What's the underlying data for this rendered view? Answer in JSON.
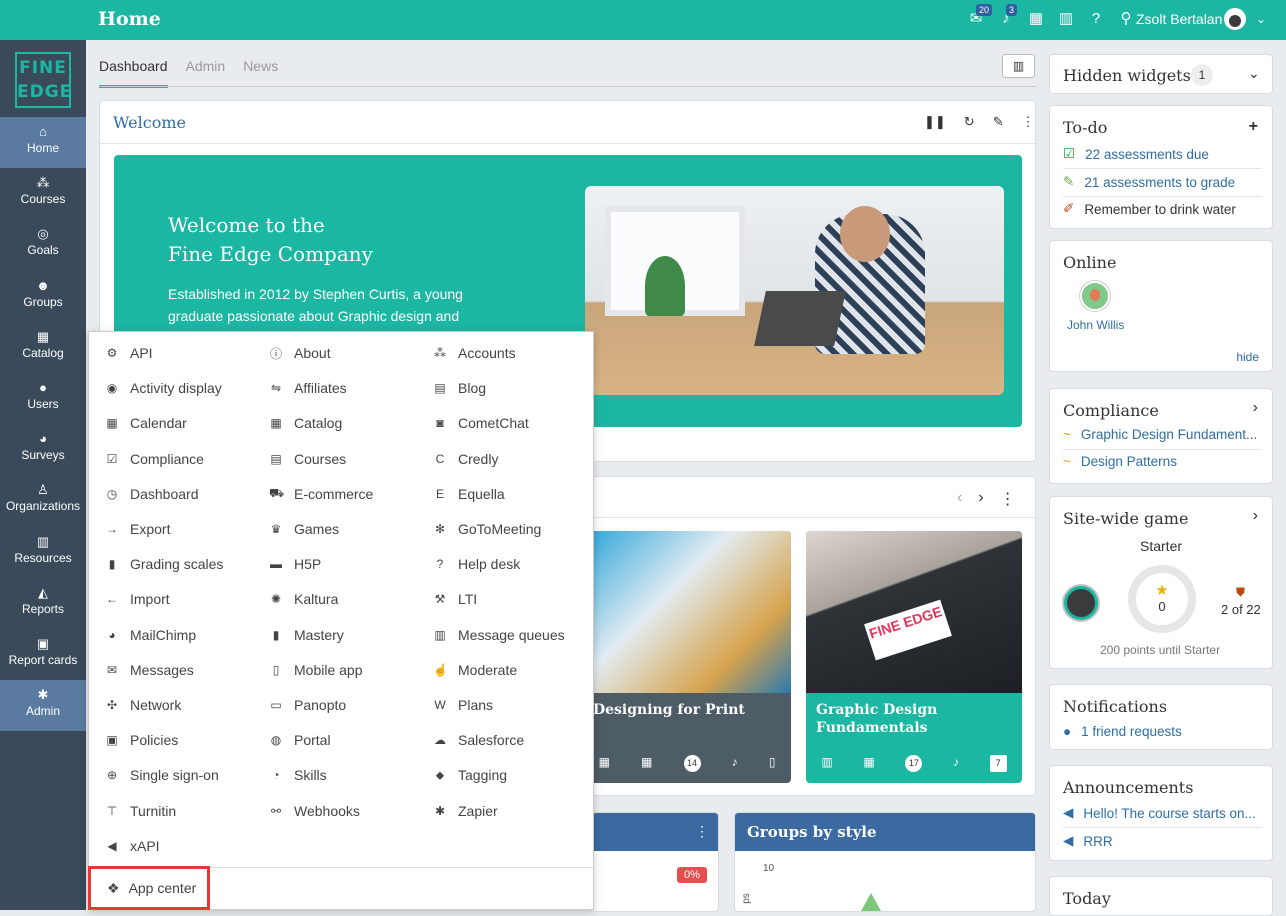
{
  "topbar": {
    "title": "Home",
    "msg_badge": "20",
    "notif_badge": "3",
    "username": "Zsolt Bertalan"
  },
  "sidebar": {
    "logo_line1": "FINE",
    "logo_line2": "EDGE",
    "items": [
      {
        "label": "Home",
        "icon": "home-icon",
        "glyph": "⌂"
      },
      {
        "label": "Courses",
        "icon": "courses-icon",
        "glyph": "⁂"
      },
      {
        "label": "Goals",
        "icon": "goals-icon",
        "glyph": "◎"
      },
      {
        "label": "Groups",
        "icon": "groups-icon",
        "glyph": "☻"
      },
      {
        "label": "Catalog",
        "icon": "catalog-icon",
        "glyph": "▦"
      },
      {
        "label": "Users",
        "icon": "users-icon",
        "glyph": "●"
      },
      {
        "label": "Surveys",
        "icon": "surveys-icon",
        "glyph": "◕"
      },
      {
        "label": "Organizations",
        "icon": "organizations-icon",
        "glyph": "♙"
      },
      {
        "label": "Resources",
        "icon": "resources-icon",
        "glyph": "▥"
      },
      {
        "label": "Reports",
        "icon": "reports-icon",
        "glyph": "◭"
      },
      {
        "label": "Report cards",
        "icon": "report-cards-icon",
        "glyph": "▣"
      },
      {
        "label": "Admin",
        "icon": "admin-icon",
        "glyph": "✱"
      }
    ]
  },
  "tabs": [
    {
      "label": "Dashboard"
    },
    {
      "label": "Admin"
    },
    {
      "label": "News"
    }
  ],
  "welcome": {
    "header": "Welcome",
    "banner_title_line1": "Welcome to the",
    "banner_title_line2": "Fine Edge Company",
    "banner_text": "Established in 2012 by Stephen Curtis, a young graduate passionate about Graphic design and teaching others. The mission to ...",
    "banner_text_visible": "Established in 2012 by Stephen Curtis, a young graduate passionate about Graphic design and"
  },
  "courses": [
    {
      "title": "Designing for Print",
      "count": "14"
    },
    {
      "title_line1": "Graphic Design",
      "title_line2": "Fundamentals",
      "count": "17",
      "badge": "7",
      "logo": "FINE EDGE"
    }
  ],
  "progress_widget": {
    "pct": "0%"
  },
  "groups_widget": {
    "title": "Groups by style",
    "axis_tick": "10",
    "axis_label": "ps"
  },
  "right": {
    "hidden_widgets": {
      "title": "Hidden widgets",
      "count": "1"
    },
    "todo": {
      "title": "To-do",
      "items": [
        {
          "text": "22 assessments due",
          "icon": "checkbox-icon"
        },
        {
          "text": "21 assessments to grade",
          "icon": "pencil-icon"
        },
        {
          "text": "Remember to drink water",
          "icon": "pin-icon"
        }
      ]
    },
    "online": {
      "title": "Online",
      "user": "John Willis",
      "hide": "hide"
    },
    "compliance": {
      "title": "Compliance",
      "items": [
        "Graphic Design Fundament...",
        "Design Patterns"
      ]
    },
    "game": {
      "title": "Site-wide game",
      "level": "Starter",
      "points": "0",
      "rank": "2 of 22",
      "until": "200 points until Starter"
    },
    "notifications": {
      "title": "Notifications",
      "item": "1 friend requests"
    },
    "announcements": {
      "title": "Announcements",
      "items": [
        "Hello! The course starts on...",
        "RRR"
      ]
    },
    "today": {
      "title": "Today"
    }
  },
  "menu": {
    "col1": [
      "API",
      "Activity display",
      "Calendar",
      "Compliance",
      "Dashboard",
      "Export",
      "Grading scales",
      "Import",
      "MailChimp",
      "Messages",
      "Network",
      "Policies",
      "Single sign-on",
      "Turnitin",
      "xAPI"
    ],
    "col2": [
      "About",
      "Affiliates",
      "Catalog",
      "Courses",
      "E-commerce",
      "Games",
      "H5P",
      "Kaltura",
      "Mastery",
      "Mobile app",
      "Panopto",
      "Portal",
      "Skills",
      "Webhooks"
    ],
    "col3": [
      "Accounts",
      "Blog",
      "CometChat",
      "Credly",
      "Equella",
      "GoToMeeting",
      "Help desk",
      "LTI",
      "Message queues",
      "Moderate",
      "Plans",
      "Salesforce",
      "Tagging",
      "Zapier"
    ],
    "app_center": "App center"
  }
}
